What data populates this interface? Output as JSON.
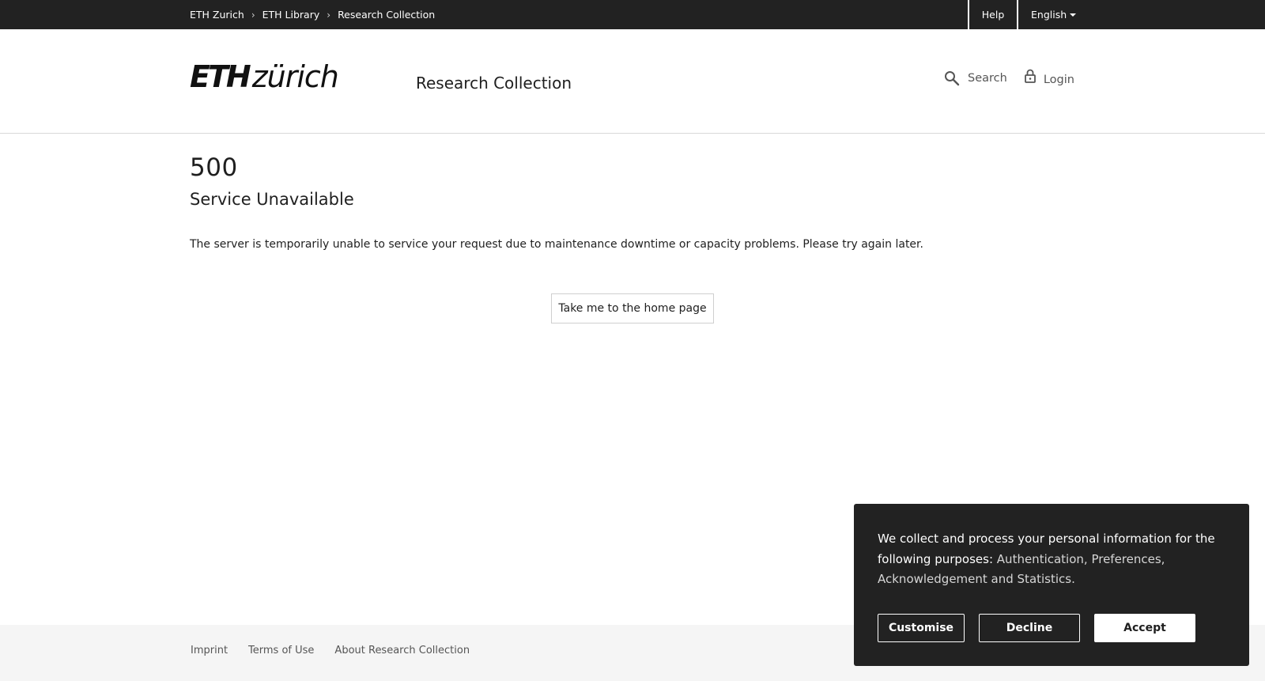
{
  "topbar": {
    "breadcrumb": [
      {
        "label": "ETH Zurich"
      },
      {
        "label": "ETH Library"
      },
      {
        "label": "Research Collection"
      }
    ],
    "separator": "›",
    "help_label": "Help",
    "language_label": "English"
  },
  "header": {
    "logo_eth": "ETH",
    "logo_zurich": "zürich",
    "site_title": "Research Collection",
    "search_label": "Search",
    "login_label": "Login"
  },
  "main": {
    "error_code": "500",
    "error_title": "Service Unavailable",
    "error_message": "The server is temporarily unable to service your request due to maintenance downtime or capacity problems. Please try again later.",
    "home_button_label": "Take me to the home page"
  },
  "footer": {
    "links": [
      {
        "label": "Imprint"
      },
      {
        "label": "Terms of Use"
      },
      {
        "label": "About Research Collection"
      }
    ]
  },
  "cookie_banner": {
    "text_lead": "We collect and process your personal information for the following purposes:",
    "text_purposes": "Authentication, Preferences, Acknowledgement and Statistics.",
    "customise_label": "Customise",
    "decline_label": "Decline",
    "accept_label": "Accept"
  },
  "colors": {
    "topbar_bg": "#222222",
    "cookie_bg": "#222222",
    "footer_bg": "#f5f5f5",
    "text": "#1f1f1f"
  },
  "icons": {
    "search": "search-icon",
    "login": "lock-icon",
    "language_caret": "caret-down-icon"
  }
}
